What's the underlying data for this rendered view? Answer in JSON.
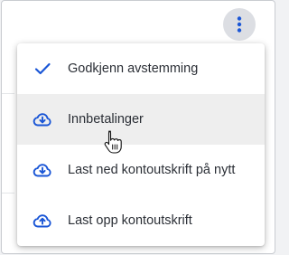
{
  "kebab_button": {
    "icon": "more-vert-icon",
    "color": "#1a56d6"
  },
  "menu": {
    "items": [
      {
        "label": "Godkjenn avstemming",
        "icon": "check-icon"
      },
      {
        "label": "Innbetalinger",
        "icon": "cloud-download-icon",
        "hovered": true
      },
      {
        "label": "Last ned kontoutskrift på nytt",
        "icon": "cloud-download-icon"
      },
      {
        "label": "Last opp kontoutskrift",
        "icon": "cloud-upload-icon"
      }
    ]
  },
  "colors": {
    "accent": "#1a56d6",
    "hover": "#eeeeee",
    "text": "#2b2f36"
  },
  "cursor": "hand-pointer-icon"
}
